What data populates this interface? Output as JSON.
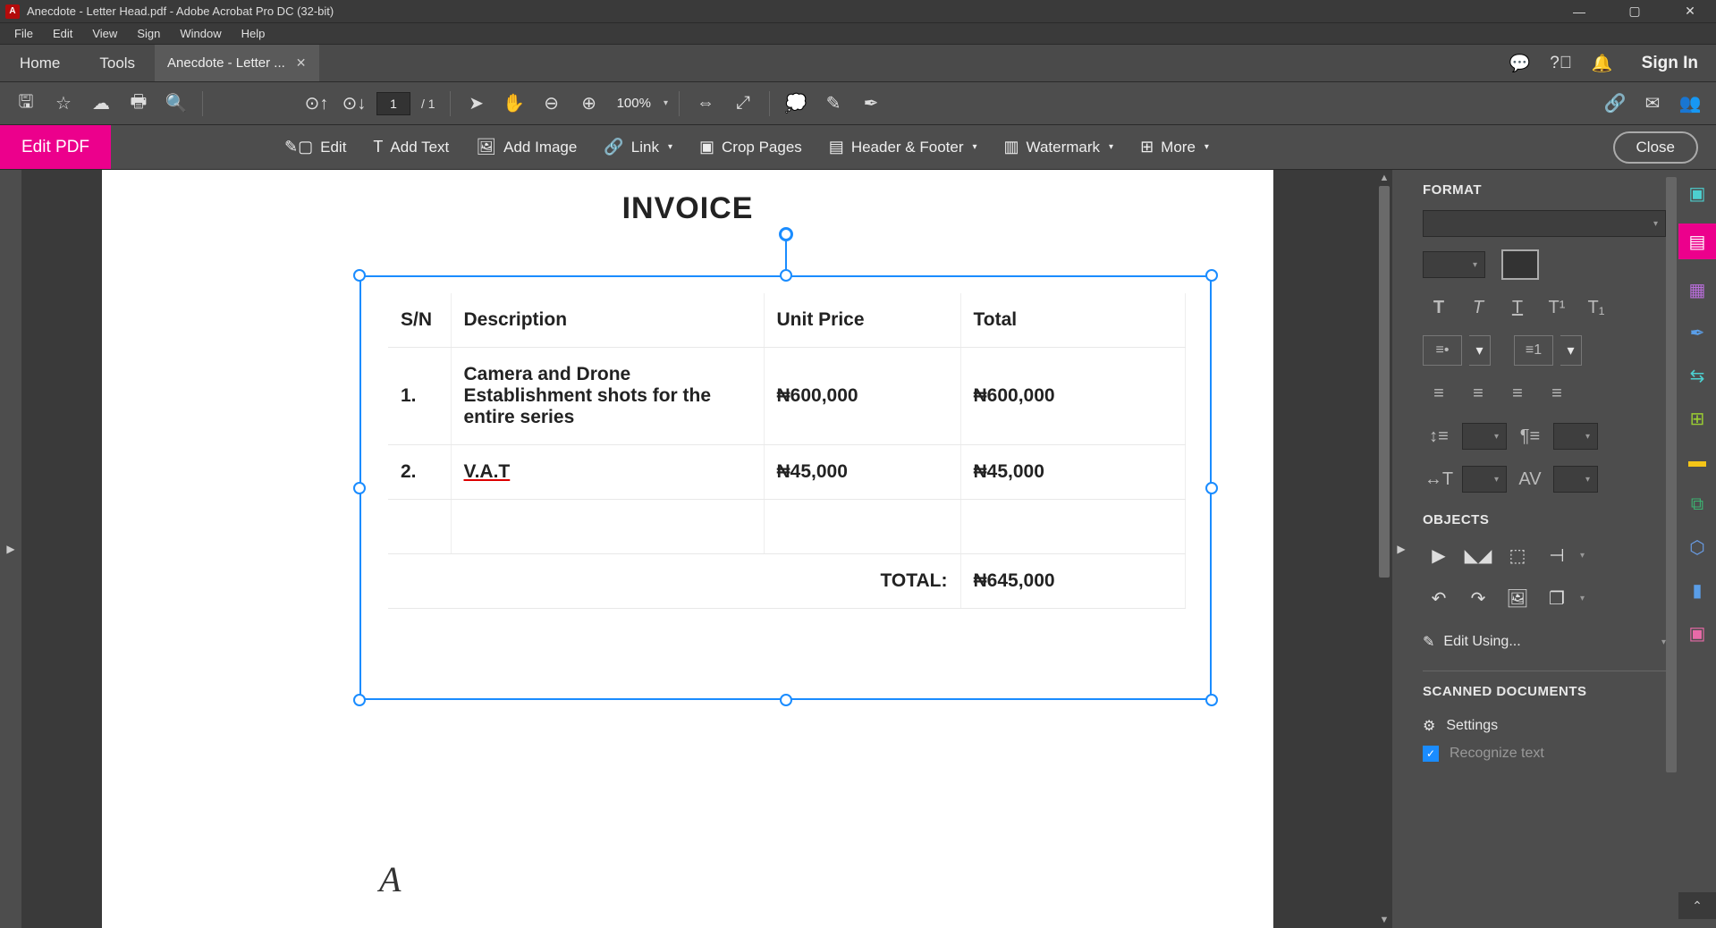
{
  "titlebar": {
    "app_icon_letter": "A",
    "title": "Anecdote - Letter Head.pdf - Adobe Acrobat Pro DC (32-bit)"
  },
  "menubar": [
    "File",
    "Edit",
    "View",
    "Sign",
    "Window",
    "Help"
  ],
  "tabs": {
    "home": "Home",
    "tools": "Tools",
    "doc_label": "Anecdote - Letter ...",
    "signin": "Sign In"
  },
  "maintoolbar": {
    "page_current": "1",
    "page_total": "/  1",
    "zoom": "100%"
  },
  "edittoolbar": {
    "label": "Edit PDF",
    "edit": "Edit",
    "add_text": "Add Text",
    "add_image": "Add Image",
    "link": "Link",
    "crop": "Crop Pages",
    "header_footer": "Header & Footer",
    "watermark": "Watermark",
    "more": "More",
    "close": "Close"
  },
  "document": {
    "heading": "INVOICE",
    "columns": {
      "sn": "S/N",
      "desc": "Description",
      "unit": "Unit Price",
      "total": "Total"
    },
    "rows": [
      {
        "sn": "1.",
        "desc": "Camera and Drone Establishment shots for the entire series",
        "unit": "₦600,000",
        "total": "₦600,000"
      },
      {
        "sn": "2.",
        "desc": "V.A.T",
        "unit": "₦45,000",
        "total": "₦45,000"
      }
    ],
    "total_label": "TOTAL:",
    "total_value": "₦645,000"
  },
  "format_panel": {
    "title": "FORMAT",
    "objects_title": "OBJECTS",
    "edit_using": "Edit Using...",
    "scanned_title": "SCANNED DOCUMENTS",
    "settings": "Settings",
    "recognize": "Recognize text"
  }
}
